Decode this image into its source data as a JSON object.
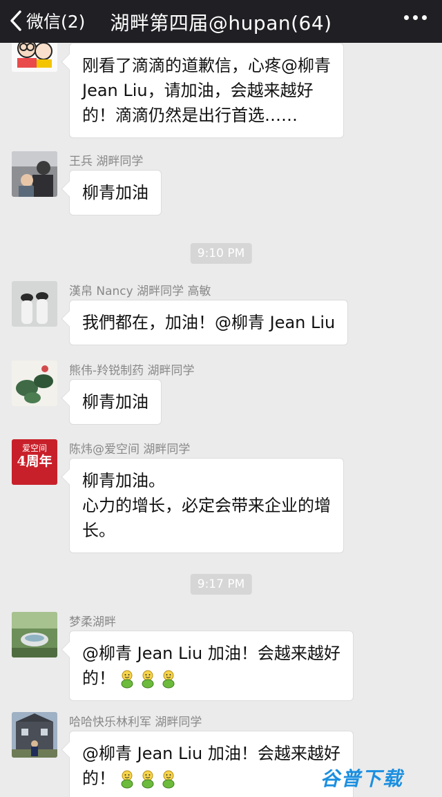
{
  "nav": {
    "back_label": "微信(2)",
    "title": "湖畔第四届@hupan(64)"
  },
  "messages": [
    {
      "sender": "",
      "lines": [
        "刚看了滴滴的道歉信，心疼@柳青",
        "Jean Liu，请加油，会越来越好",
        "的！滴滴仍然是出行首选……"
      ]
    },
    {
      "sender": "王兵 湖畔同学",
      "lines": [
        "柳青加油"
      ]
    },
    {
      "sender": "漢帛 Nancy 湖畔同学 高敏",
      "lines": [
        "我們都在，加油！@柳青 Jean Liu"
      ]
    },
    {
      "sender": "熊伟-羚锐制药 湖畔同学",
      "lines": [
        "柳青加油"
      ]
    },
    {
      "sender": "陈炜@爱空间 湖畔同学",
      "avatar_text": [
        "爱空间",
        "4周年"
      ],
      "lines": [
        "柳青加油。",
        "心力的增长，必定会带来企业的增",
        "长。"
      ]
    },
    {
      "sender": "梦柔湖畔",
      "lines": [
        "@柳青 Jean Liu 加油！会越来越好",
        "的！"
      ]
    },
    {
      "sender": "哈哈快乐林利军 湖畔同学",
      "lines": [
        "@柳青 Jean Liu 加油！会越来越好",
        "的！"
      ]
    }
  ],
  "timestamps": [
    "9:10 PM",
    "9:17 PM"
  ],
  "emoji_name": "cheer-emoji",
  "watermark": "谷普下载"
}
